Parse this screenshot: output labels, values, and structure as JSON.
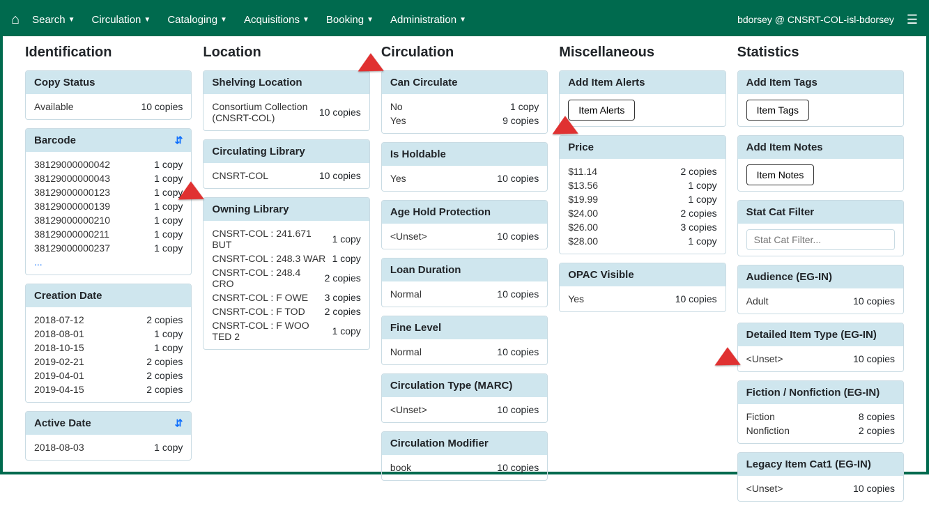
{
  "nav": {
    "items": [
      "Search",
      "Circulation",
      "Cataloging",
      "Acquisitions",
      "Booking",
      "Administration"
    ],
    "user": "bdorsey @ CNSRT-COL-isl-bdorsey"
  },
  "columns": {
    "identification": {
      "title": "Identification",
      "copy_status": {
        "header": "Copy Status",
        "rows": [
          {
            "v": "Available",
            "c": "10 copies"
          }
        ]
      },
      "barcode": {
        "header": "Barcode",
        "rows": [
          {
            "v": "38129000000042",
            "c": "1 copy"
          },
          {
            "v": "38129000000043",
            "c": "1 copy"
          },
          {
            "v": "38129000000123",
            "c": "1 copy"
          },
          {
            "v": "38129000000139",
            "c": "1 copy"
          },
          {
            "v": "38129000000210",
            "c": "1 copy"
          },
          {
            "v": "38129000000211",
            "c": "1 copy"
          },
          {
            "v": "38129000000237",
            "c": "1 copy"
          }
        ],
        "more": "..."
      },
      "creation_date": {
        "header": "Creation Date",
        "rows": [
          {
            "v": "2018-07-12",
            "c": "2 copies"
          },
          {
            "v": "2018-08-01",
            "c": "1 copy"
          },
          {
            "v": "2018-10-15",
            "c": "1 copy"
          },
          {
            "v": "2019-02-21",
            "c": "2 copies"
          },
          {
            "v": "2019-04-01",
            "c": "2 copies"
          },
          {
            "v": "2019-04-15",
            "c": "2 copies"
          }
        ]
      },
      "active_date": {
        "header": "Active Date",
        "rows": [
          {
            "v": "2018-08-03",
            "c": "1 copy"
          }
        ]
      }
    },
    "location": {
      "title": "Location",
      "shelving_location": {
        "header": "Shelving Location",
        "rows": [
          {
            "v": "Consortium Collection (CNSRT-COL)",
            "c": "10 copies"
          }
        ]
      },
      "circulating_library": {
        "header": "Circulating Library",
        "rows": [
          {
            "v": "CNSRT-COL",
            "c": "10 copies"
          }
        ]
      },
      "owning_library": {
        "header": "Owning Library",
        "rows": [
          {
            "v": "CNSRT-COL : 241.671 BUT",
            "c": "1 copy"
          },
          {
            "v": "CNSRT-COL : 248.3 WAR",
            "c": "1 copy"
          },
          {
            "v": "CNSRT-COL : 248.4 CRO",
            "c": "2 copies"
          },
          {
            "v": "CNSRT-COL : F OWE",
            "c": "3 copies"
          },
          {
            "v": "CNSRT-COL : F TOD",
            "c": "2 copies"
          },
          {
            "v": "CNSRT-COL : F WOO TED 2",
            "c": "1 copy"
          }
        ]
      }
    },
    "circulation": {
      "title": "Circulation",
      "can_circulate": {
        "header": "Can Circulate",
        "rows": [
          {
            "v": "No",
            "c": "1 copy"
          },
          {
            "v": "Yes",
            "c": "9 copies"
          }
        ]
      },
      "is_holdable": {
        "header": "Is Holdable",
        "rows": [
          {
            "v": "Yes",
            "c": "10 copies"
          }
        ]
      },
      "age_hold": {
        "header": "Age Hold Protection",
        "rows": [
          {
            "v": "Unset",
            "c": "10 copies",
            "unset": true
          }
        ]
      },
      "loan_duration": {
        "header": "Loan Duration",
        "rows": [
          {
            "v": "Normal",
            "c": "10 copies"
          }
        ]
      },
      "fine_level": {
        "header": "Fine Level",
        "rows": [
          {
            "v": "Normal",
            "c": "10 copies"
          }
        ]
      },
      "circ_type": {
        "header": "Circulation Type (MARC)",
        "rows": [
          {
            "v": "Unset",
            "c": "10 copies",
            "unset": true
          }
        ]
      },
      "circ_modifier": {
        "header": "Circulation Modifier",
        "rows": [
          {
            "v": "book",
            "c": "10 copies"
          }
        ]
      }
    },
    "misc": {
      "title": "Miscellaneous",
      "add_item_alerts": {
        "header": "Add Item Alerts",
        "button": "Item Alerts"
      },
      "price": {
        "header": "Price",
        "rows": [
          {
            "v": "$11.14",
            "c": "2 copies"
          },
          {
            "v": "$13.56",
            "c": "1 copy"
          },
          {
            "v": "$19.99",
            "c": "1 copy"
          },
          {
            "v": "$24.00",
            "c": "2 copies"
          },
          {
            "v": "$26.00",
            "c": "3 copies"
          },
          {
            "v": "$28.00",
            "c": "1 copy"
          }
        ]
      },
      "opac_visible": {
        "header": "OPAC Visible",
        "rows": [
          {
            "v": "Yes",
            "c": "10 copies"
          }
        ]
      }
    },
    "statistics": {
      "title": "Statistics",
      "add_item_tags": {
        "header": "Add Item Tags",
        "button": "Item Tags"
      },
      "add_item_notes": {
        "header": "Add Item Notes",
        "button": "Item Notes"
      },
      "stat_cat_filter": {
        "header": "Stat Cat Filter",
        "placeholder": "Stat Cat Filter..."
      },
      "audience": {
        "header": "Audience (EG-IN)",
        "rows": [
          {
            "v": "Adult",
            "c": "10 copies"
          }
        ]
      },
      "detailed_item_type": {
        "header": "Detailed Item Type (EG-IN)",
        "rows": [
          {
            "v": "Unset",
            "c": "10 copies",
            "unset": true
          }
        ]
      },
      "fiction_nonfiction": {
        "header": "Fiction / Nonfiction (EG-IN)",
        "rows": [
          {
            "v": "Fiction",
            "c": "8 copies"
          },
          {
            "v": "Nonfiction",
            "c": "2 copies"
          }
        ]
      },
      "legacy_item_cat1": {
        "header": "Legacy Item Cat1 (EG-IN)",
        "rows": [
          {
            "v": "Unset",
            "c": "10 copies",
            "unset": true
          }
        ]
      }
    }
  }
}
